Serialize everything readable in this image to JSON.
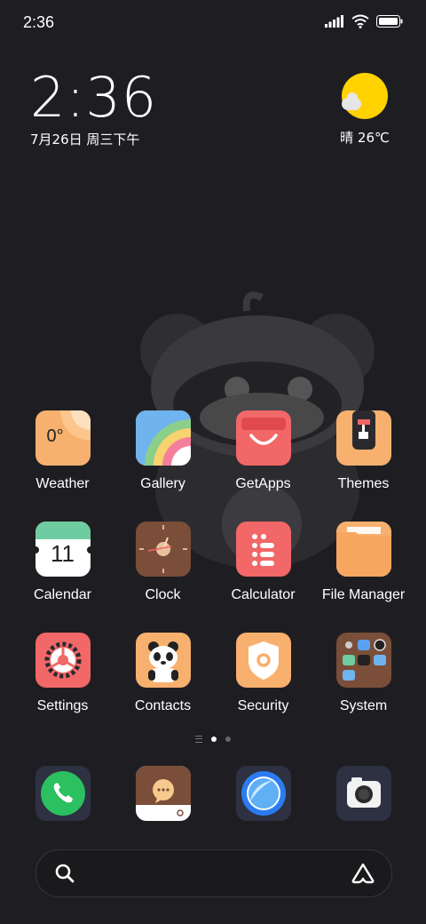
{
  "status_bar": {
    "time": "2:36"
  },
  "clock_widget": {
    "time": "2:36",
    "date": "7月26日 周三下午"
  },
  "weather_widget": {
    "text": "晴 26℃"
  },
  "apps": [
    [
      {
        "label": "Weather",
        "name": "weather",
        "icon": "weather-icon",
        "tile_text": "0°"
      },
      {
        "label": "Gallery",
        "name": "gallery",
        "icon": "gallery-icon"
      },
      {
        "label": "GetApps",
        "name": "getapps",
        "icon": "shopping-bag-icon"
      },
      {
        "label": "Themes",
        "name": "themes",
        "icon": "paint-roller-icon"
      }
    ],
    [
      {
        "label": "Calendar",
        "name": "calendar",
        "icon": "calendar-icon",
        "tile_text": "11"
      },
      {
        "label": "Clock",
        "name": "clock",
        "icon": "clock-icon"
      },
      {
        "label": "Calculator",
        "name": "calculator",
        "icon": "calculator-icon"
      },
      {
        "label": "File Manager",
        "name": "file-manager",
        "icon": "folder-icon"
      }
    ],
    [
      {
        "label": "Settings",
        "name": "settings",
        "icon": "gear-icon"
      },
      {
        "label": "Contacts",
        "name": "contacts",
        "icon": "panda-icon"
      },
      {
        "label": "Security",
        "name": "security",
        "icon": "shield-icon"
      },
      {
        "label": "System",
        "name": "system-folder",
        "icon": "folder-grid-icon"
      }
    ]
  ],
  "dock": [
    {
      "name": "phone",
      "icon": "phone-icon"
    },
    {
      "name": "messaging",
      "icon": "chat-bubble-icon"
    },
    {
      "name": "browser",
      "icon": "browser-icon"
    },
    {
      "name": "camera",
      "icon": "camera-icon"
    }
  ],
  "colors": {
    "background": "#1e1e22",
    "accent_orange": "#f8b06e",
    "accent_red": "#f06566",
    "sun_yellow": "#ffd200",
    "phone_green": "#2bc060"
  }
}
